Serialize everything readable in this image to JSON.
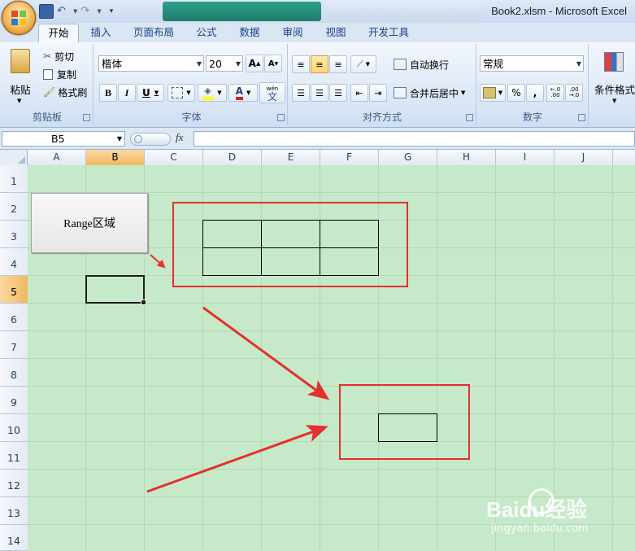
{
  "window": {
    "title": "Book2.xlsm - Microsoft Excel"
  },
  "colors": {
    "sheet_bg": "#c6e9c9",
    "accent_red": "#e4302c",
    "ribbon_text": "#15428b"
  },
  "ribbon": {
    "tabs": [
      "开始",
      "插入",
      "页面布局",
      "公式",
      "数据",
      "审阅",
      "视图",
      "开发工具"
    ],
    "active_tab": "开始",
    "clipboard": {
      "paste": "粘贴",
      "cut": "剪切",
      "copy": "复制",
      "format_painter": "格式刷",
      "label": "剪贴板"
    },
    "font": {
      "name": "楷体",
      "size": "20",
      "label": "字体",
      "bold": "B",
      "italic": "I",
      "underline": "U",
      "grow": "A",
      "shrink": "A",
      "font_color": "A",
      "wen": "wén",
      "wen_char": "文"
    },
    "alignment": {
      "wrap": "自动换行",
      "merge": "合并后居中",
      "label": "对齐方式"
    },
    "number": {
      "format": "常规",
      "percent": "%",
      "comma": ",",
      "inc_decimal": "←.0 .00",
      "dec_decimal": ".00 →.0",
      "label": "数字"
    },
    "styles": {
      "conditional": "条件格式"
    }
  },
  "formula_bar": {
    "name_box": "B5",
    "fx": "fx",
    "content": ""
  },
  "grid": {
    "columns": [
      "A",
      "B",
      "C",
      "D",
      "E",
      "F",
      "G",
      "H",
      "I",
      "J"
    ],
    "rows": [
      "1",
      "2",
      "3",
      "4",
      "5",
      "6",
      "7",
      "8",
      "9",
      "10",
      "11",
      "12",
      "13",
      "14"
    ],
    "selected_column": "B",
    "selected_row": "5"
  },
  "sheet_button": {
    "label": "Range区域"
  },
  "watermark": {
    "brand": "Baidu经验",
    "url": "jingyan.baidu.com"
  }
}
